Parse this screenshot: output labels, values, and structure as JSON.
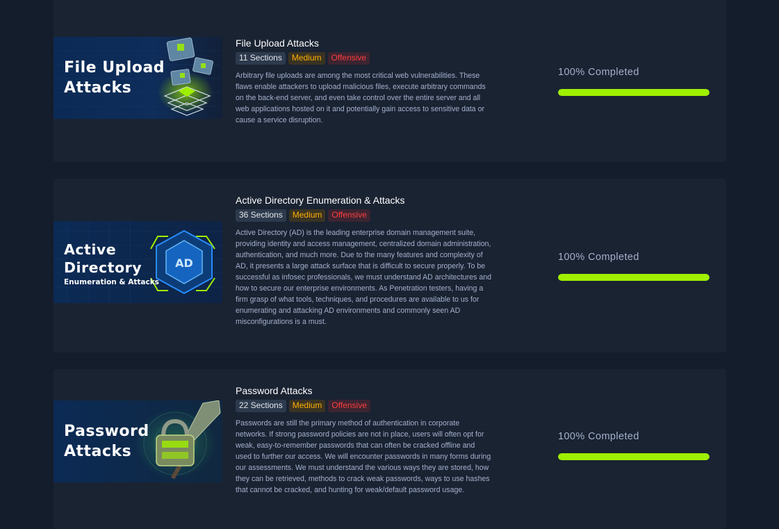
{
  "modules": [
    {
      "thumb_text": "File Upload\nAttacks",
      "thumb_sub": "",
      "title": "File Upload Attacks",
      "sections": "11 Sections",
      "difficulty": "Medium",
      "category": "Offensive",
      "description": "Arbitrary file uploads are among the most critical web vulnerabilities. These flaws enable attackers to upload malicious files, execute arbitrary commands on the back-end server, and even take control over the entire server and all web applications hosted on it and potentially gain access to sensitive data or cause a service disruption.",
      "progress_label": "100% Completed",
      "progress": 1.0
    },
    {
      "thumb_text": "Active\nDirectory",
      "thumb_sub": "Enumeration & Attacks",
      "title": "Active Directory Enumeration & Attacks",
      "sections": "36 Sections",
      "difficulty": "Medium",
      "category": "Offensive",
      "description": "Active Directory (AD) is the leading enterprise domain management suite, providing identity and access management, centralized domain administration, authentication, and much more. Due to the many features and complexity of AD, it presents a large attack surface that is difficult to secure properly. To be successful as infosec professionals, we must understand AD architectures and how to secure our enterprise environments. As Penetration testers, having a firm grasp of what tools, techniques, and procedures are available to us for enumerating and attacking AD environments and commonly seen AD misconfigurations is a must.",
      "progress_label": "100% Completed",
      "progress": 1.0
    },
    {
      "thumb_text": "Password\nAttacks",
      "thumb_sub": "",
      "title": "Password Attacks",
      "sections": "22 Sections",
      "difficulty": "Medium",
      "category": "Offensive",
      "description": "Passwords are still the primary method of authentication in corporate networks. If strong password policies are not in place, users will often opt for weak, easy-to-remember passwords that can often be cracked offline and used to further our access. We will encounter passwords in many forms during our assessments. We must understand the various ways they are stored, how they can be retrieved, methods to crack weak passwords, ways to use hashes that cannot be cracked, and hunting for weak/default password usage.",
      "progress_label": "100% Completed",
      "progress": 1.0
    }
  ],
  "colors": {
    "background": "#141d2b",
    "card": "#1a2332",
    "progress_fill": "#9fef00",
    "medium": "#ffaf00",
    "offensive": "#ff3e3e"
  },
  "icons": [
    "folder-cube-icon",
    "ad-shield-icon",
    "padlock-hammer-icon"
  ]
}
